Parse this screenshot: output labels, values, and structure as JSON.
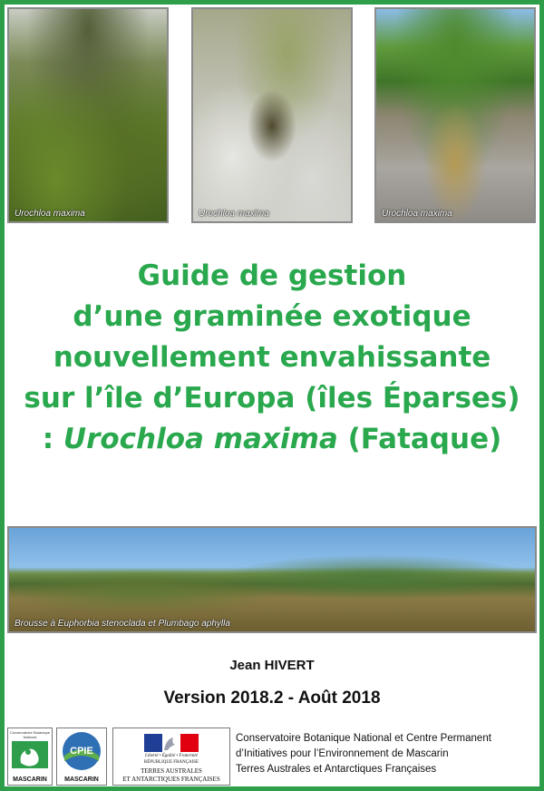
{
  "photos": [
    {
      "caption": "Urochloa maxima"
    },
    {
      "caption": "Urochloa maxima"
    },
    {
      "caption": "Urochloa maxima"
    }
  ],
  "title": {
    "line1": "Guide de gestion",
    "line2": "d’une graminée exotique",
    "line3": "nouvellement envahissante",
    "line4": "sur l’île d’Europa (îles Éparses)",
    "line5_prefix": ": ",
    "line5_italic": "Urochloa maxima",
    "line5_suffix": " (Fataque)"
  },
  "landscape": {
    "caption": "Brousse à Euphorbia stenoclada et Plumbago aphylla"
  },
  "author": "Jean HIVERT",
  "version": "Version 2018.2 - Août 2018",
  "logos": {
    "cbn_top": "Conservatoire Botanique National",
    "cbn_bottom": "MASCARIN",
    "cpie_bottom": "MASCARIN",
    "rf_motto": "Liberté • Égalité • Fraternité",
    "rf_name": "RÉPUBLIQUE FRANÇAISE",
    "taaf_line1": "TERRES AUSTRALES",
    "taaf_line2": "ET ANTARCTIQUES FRANÇAISES"
  },
  "organizations": {
    "line1": "Conservatoire Botanique National et Centre Permanent",
    "line2": "d’Initiatives pour l’Environnement de Mascarin",
    "line3": "Terres Australes et Antarctiques Françaises"
  },
  "colors": {
    "title_green": "#2aa84e",
    "frame_green": "#2e9e4b",
    "tricolor_blue": "#1f3e96",
    "tricolor_red": "#e1000f"
  }
}
